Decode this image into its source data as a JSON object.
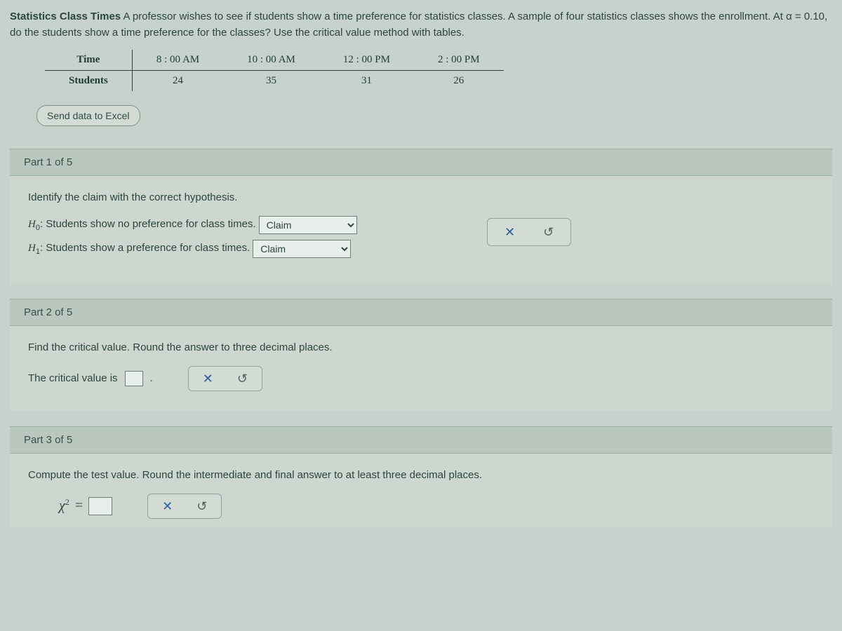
{
  "problem": {
    "title": "Statistics Class Times",
    "text": "A professor wishes to see if students show a time preference for statistics classes. A sample of four statistics classes shows the enrollment. At α = 0.10, do the students show a time preference for the classes? Use the critical value method with tables."
  },
  "table": {
    "row_labels": [
      "Time",
      "Students"
    ],
    "columns": [
      "8 : 00 AM",
      "10 : 00 AM",
      "12 : 00 PM",
      "2 : 00 PM"
    ],
    "values": [
      24,
      35,
      31,
      26
    ]
  },
  "buttons": {
    "excel": "Send data to Excel"
  },
  "parts": {
    "p1": {
      "header": "Part 1 of 5",
      "instruction": "Identify the claim with the correct hypothesis.",
      "h0_label": "H",
      "h0_sub": "0",
      "h0_text": ": Students show no preference for class times.",
      "h1_label": "H",
      "h1_sub": "1",
      "h1_text": ": Students show a preference for class times.",
      "select_value": "Claim"
    },
    "p2": {
      "header": "Part 2 of 5",
      "instruction": "Find the critical value. Round the answer to three decimal places.",
      "cv_text": "The critical value is",
      "cv_period": "."
    },
    "p3": {
      "header": "Part 3 of 5",
      "instruction": "Compute the test value. Round the intermediate and final answer to at least three decimal places.",
      "chi": "χ",
      "chi_sup": "2",
      "eq": "="
    }
  },
  "icons": {
    "x": "✕",
    "reset": "↺"
  }
}
